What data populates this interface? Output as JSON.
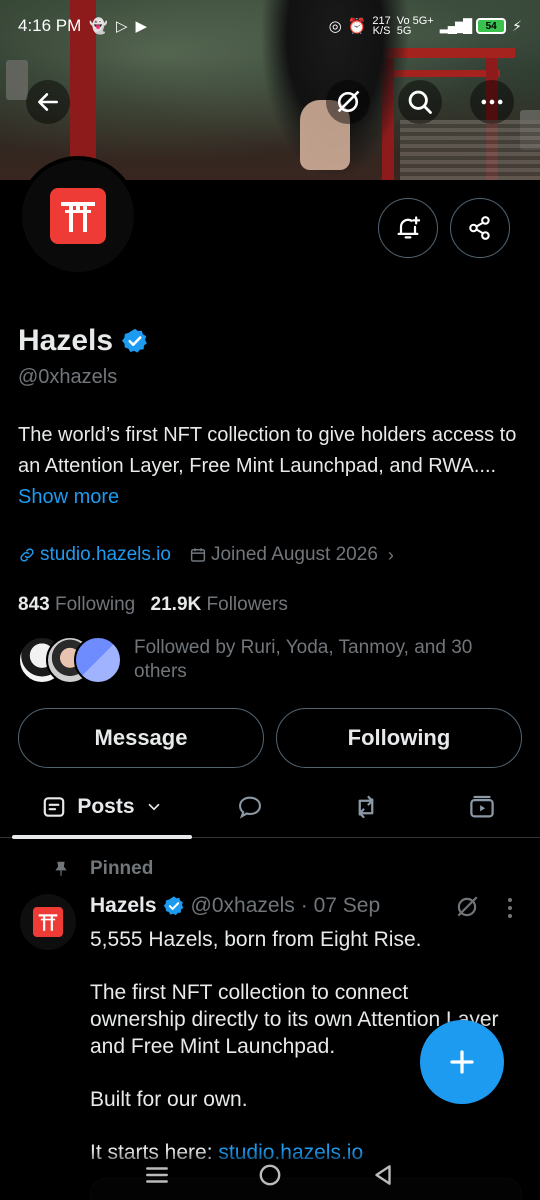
{
  "status_bar": {
    "time": "4:16 PM",
    "speed_value": "217",
    "speed_unit": "K/S",
    "network_top": "Vo 5G+",
    "network_bottom": "5G",
    "battery": "54"
  },
  "profile": {
    "name": "Hazels",
    "handle": "@0xhazels",
    "bio_text": "The world’s first NFT collection to give holders access to an Attention Layer, Free Mint Launchpad, and RWA.... ",
    "show_more": "Show more",
    "website": "studio.hazels.io",
    "joined": "Joined August 2026",
    "following_count": "843",
    "following_label": "Following",
    "followers_count": "21.9K",
    "followers_label": "Followers",
    "followed_by": "Followed by Ruri, Yoda, Tanmoy, and 30 others"
  },
  "buttons": {
    "message": "Message",
    "following": "Following"
  },
  "tabs": {
    "posts": "Posts"
  },
  "post": {
    "pinned_label": "Pinned",
    "author_name": "Hazels",
    "author_handle": "@0xhazels",
    "date": "· 07 Sep",
    "paragraphs": [
      "5,555 Hazels, born from Eight Rise.",
      "The first NFT collection to connect ownership directly to its own Attention Layer and Free Mint Launchpad.",
      "Built for our own."
    ],
    "last_line_prefix": "It starts here: ",
    "last_line_link": "studio.hazels.io"
  },
  "colors": {
    "accent": "#1d9bf0",
    "brand_red": "#ef3b36",
    "muted": "#71767b"
  }
}
